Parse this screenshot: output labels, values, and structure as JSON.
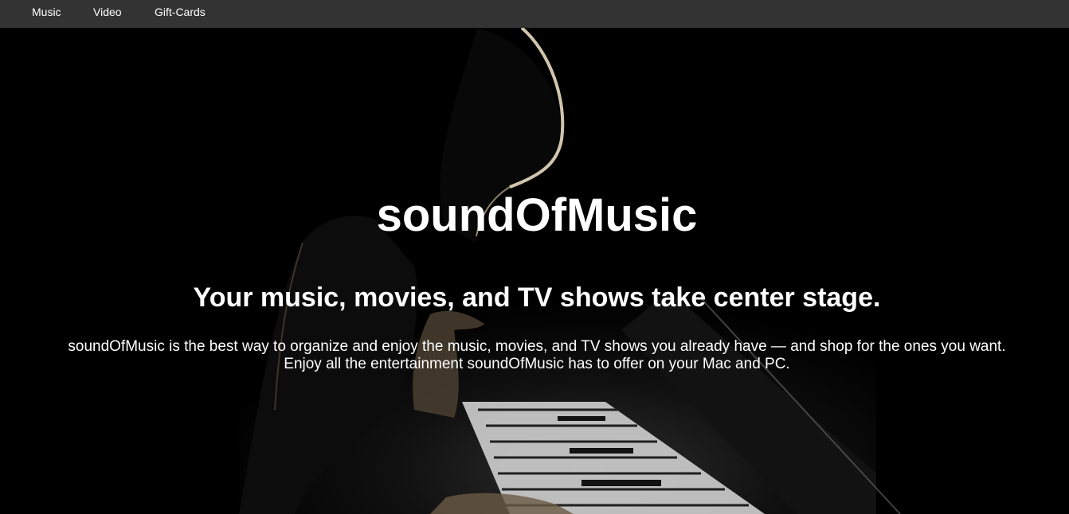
{
  "nav": {
    "items": [
      {
        "label": "Music"
      },
      {
        "label": "Video"
      },
      {
        "label": "Gift-Cards"
      }
    ]
  },
  "hero": {
    "title": "soundOfMusic",
    "subtitle": "Your music, movies, and TV shows take center stage.",
    "line1": "soundOfMusic is the best way to organize and enjoy the music, movies, and TV shows you already have — and shop for the ones you want.",
    "line2": "Enjoy all the entertainment soundOfMusic has to offer on your Mac and PC."
  },
  "colors": {
    "navbar_bg": "#333333",
    "text": "#ffffff",
    "background": "#000000"
  }
}
